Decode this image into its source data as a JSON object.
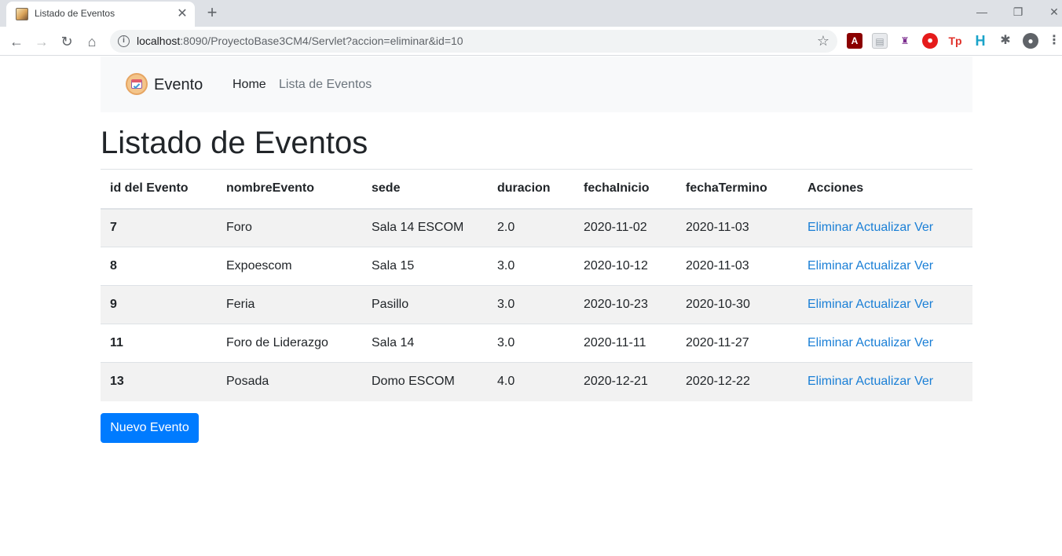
{
  "browser": {
    "tab_title": "Listado de Eventos",
    "tab_close": "✕",
    "new_tab": "+",
    "url_host": "localhost",
    "url_path": ":8090/ProyectoBase3CM4/Servlet?accion=eliminar&id=10"
  },
  "navbar": {
    "brand": "Evento",
    "links": [
      "Home",
      "Lista de Eventos"
    ]
  },
  "page": {
    "title": "Listado de Eventos",
    "new_button": "Nuevo Evento"
  },
  "table": {
    "headers": [
      "id del Evento",
      "nombreEvento",
      "sede",
      "duracion",
      "fechaInicio",
      "fechaTermino",
      "Acciones"
    ],
    "actions": [
      "Eliminar",
      "Actualizar",
      "Ver"
    ],
    "rows": [
      [
        "7",
        "Foro",
        "Sala 14 ESCOM",
        "2.0",
        "2020-11-02",
        "2020-11-03"
      ],
      [
        "8",
        "Expoescom",
        "Sala 15",
        "3.0",
        "2020-10-12",
        "2020-11-03"
      ],
      [
        "9",
        "Feria",
        "Pasillo",
        "3.0",
        "2020-10-23",
        "2020-10-30"
      ],
      [
        "11",
        "Foro de Liderazgo",
        "Sala 14",
        "3.0",
        "2020-11-11",
        "2020-11-27"
      ],
      [
        "13",
        "Posada",
        "Domo ESCOM",
        "4.0",
        "2020-12-21",
        "2020-12-22"
      ]
    ]
  },
  "colors": {
    "primary": "#007bff",
    "link": "#1a7fd6",
    "navbar_bg": "#f8f9fa",
    "stripe": "#f2f2f2"
  }
}
